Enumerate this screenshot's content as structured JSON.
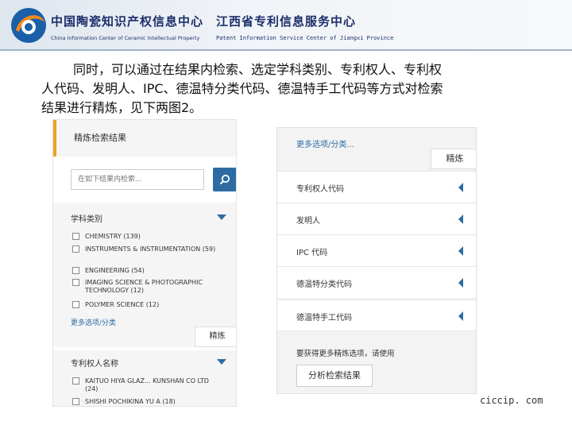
{
  "header": {
    "org1_cn": "中国陶瓷知识产权信息中心",
    "org1_en": "China Information Center of Ceramic Intellectual Property",
    "org2_cn": "江西省专利信息服务中心",
    "org2_en": "Patent Information Service Center of Jiangxi Province"
  },
  "paragraph": {
    "line1": "同时，可以通过在结果内检索、选定学科类别、专利权人、专利权",
    "line2": "人代码、发明人、IPC、德温特分类代码、德温特手工代码等方式对检索",
    "line3": "结果进行精炼，见下两图2。"
  },
  "panel1": {
    "title": "精炼检索结果",
    "search_placeholder": "在如下结果内检索...",
    "section1_title": "学科类别",
    "items": [
      "CHEMISTRY (139)",
      "INSTRUMENTS & INSTRUMENTATION (59)",
      "ENGINEERING (54)",
      "IMAGING SCIENCE & PHOTOGRAPHIC TECHNOLOGY (12)",
      "POLYMER SCIENCE (12)"
    ],
    "more_options": "更多选项/分类",
    "refine_label": "精炼",
    "section2_title": "专利权人名称",
    "items2": [
      "KAITUO HIYA GLAZ... KUNSHAN CO LTD (24)",
      "SHISHI POCHIKINA YU A (18)"
    ]
  },
  "panel2": {
    "more_options": "更多选项/分类...",
    "refine_label": "精炼",
    "rows": [
      "专利权人代码",
      "发明人",
      "IPC 代码",
      "德温特分类代码",
      "德温特手工代码"
    ],
    "note": "要获得更多精炼选项，请使用",
    "analyze_button": "分析检索结果"
  },
  "footer": {
    "url": "ciccip. com"
  },
  "colors": {
    "accent_blue": "#2d6ca2",
    "accent_orange": "#f0a020",
    "header_text": "#1c2f6b"
  }
}
